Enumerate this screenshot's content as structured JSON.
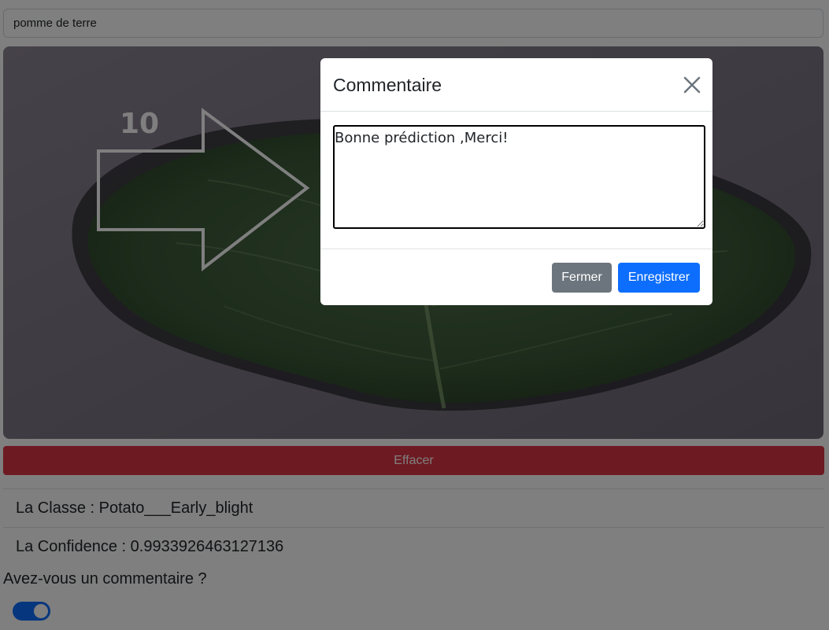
{
  "crop_input": {
    "value": "pomme de terre"
  },
  "image": {
    "step_number": "10",
    "leaf_color": "#3c5a3a",
    "background_color": "#8a8290"
  },
  "clear_button": {
    "label": "Effacer",
    "color": "#dc3545"
  },
  "results": {
    "class_text": "La Classe : Potato___Early_blight",
    "confidence_text": "La Confidence : 0.9933926463127136"
  },
  "comment_prompt": {
    "question": "Avez-vous un commentaire ?",
    "toggle_on": true
  },
  "modal": {
    "title": "Commentaire",
    "textarea_value": "Bonne prédiction ,Merci!",
    "close_label": "Fermer",
    "save_label": "Enregistrer",
    "icons": {
      "close": "close-icon"
    }
  },
  "colors": {
    "primary": "#0d6efd",
    "secondary": "#6c757d",
    "danger": "#dc3545"
  }
}
